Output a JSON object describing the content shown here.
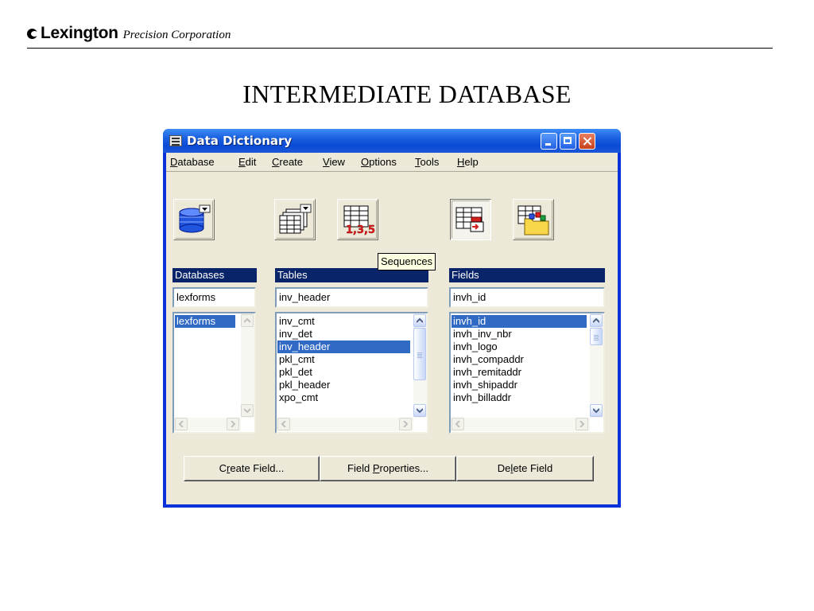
{
  "slide": {
    "brand_name": "Lexington",
    "brand_sub": "Precision Corporation",
    "title": "INTERMEDIATE DATABASE"
  },
  "window": {
    "title": "Data Dictionary",
    "menu": [
      {
        "pre": "",
        "u": "D",
        "post": "atabase"
      },
      {
        "pre": "",
        "u": "E",
        "post": "dit"
      },
      {
        "pre": "",
        "u": "C",
        "post": "reate"
      },
      {
        "pre": "",
        "u": "V",
        "post": "iew"
      },
      {
        "pre": "",
        "u": "O",
        "post": "ptions"
      },
      {
        "pre": "",
        "u": "T",
        "post": "ools"
      },
      {
        "pre": "",
        "u": "H",
        "post": "elp"
      }
    ],
    "toolbar": {
      "tooltip": "Sequences",
      "icons": [
        "database-dropdown-icon",
        "tables-dropdown-icon",
        "sequences-icon",
        "fields-icon",
        "folder-objects-icon"
      ]
    },
    "databases": {
      "header": "Databases",
      "value": "lexforms",
      "items": [
        "lexforms"
      ],
      "selected": 0
    },
    "tables": {
      "header": "Tables",
      "value": "inv_header",
      "items": [
        "inv_cmt",
        "inv_det",
        "inv_header",
        "pkl_cmt",
        "pkl_det",
        "pkl_header",
        "xpo_cmt"
      ],
      "selected": 2
    },
    "fields": {
      "header": "Fields",
      "value": "invh_id",
      "items": [
        "invh_id",
        "invh_inv_nbr",
        "invh_logo",
        "invh_compaddr",
        "invh_remitaddr",
        "invh_shipaddr",
        "invh_billaddr"
      ],
      "selected": 0
    },
    "buttons": {
      "create": {
        "pre": "C",
        "u": "r",
        "post": "eate Field..."
      },
      "properties": {
        "pre": "Field ",
        "u": "P",
        "post": "roperties..."
      },
      "delete": {
        "pre": "De",
        "u": "l",
        "post": "ete Field"
      }
    }
  },
  "colors": {
    "titlebar": "#0a4bd6",
    "selection": "#316ac5",
    "column_header": "#0a246a",
    "client": "#ece9d8"
  }
}
